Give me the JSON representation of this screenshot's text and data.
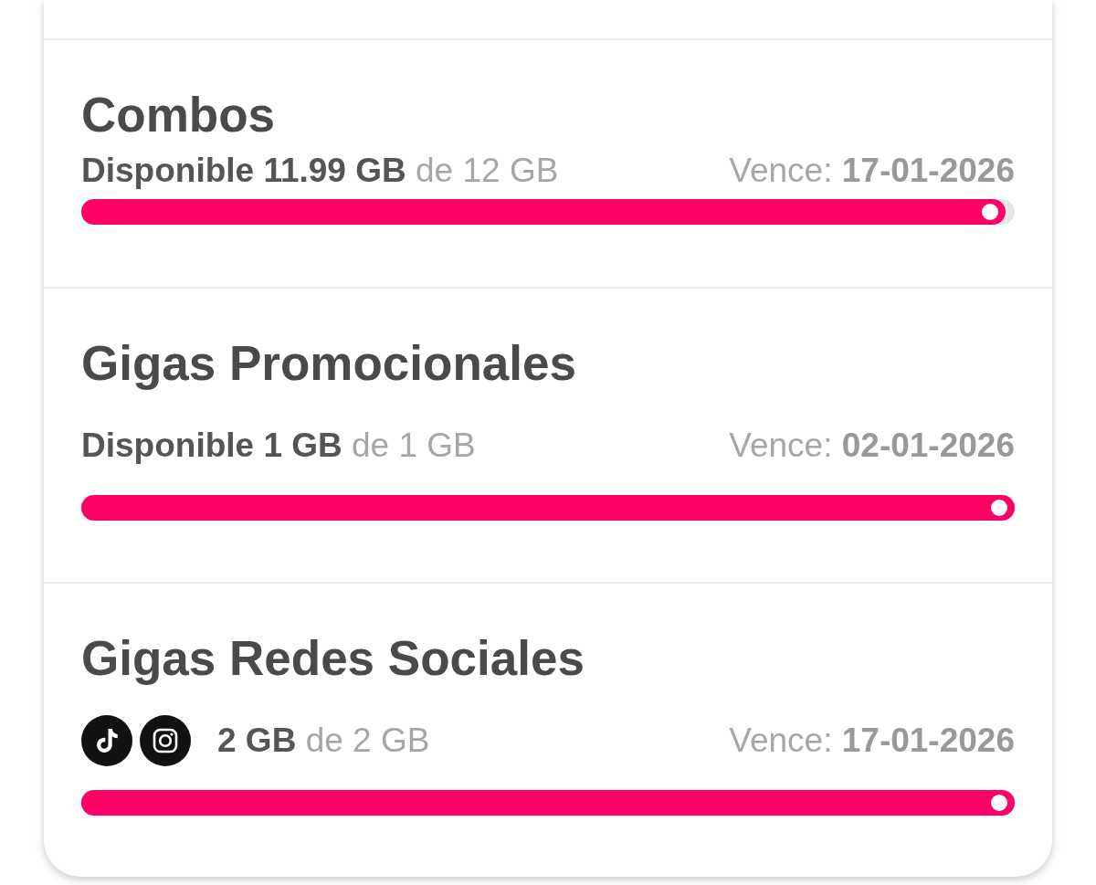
{
  "sections": [
    {
      "title": "Combos",
      "amount": "**Disponible 11.99 GB** de 12 GB",
      "expires": "Vence: **17-01-2026**",
      "level": 0.99
    },
    {
      "title": "Gigas Promocionales",
      "amount": "**Disponible 1 GB** de 1 GB",
      "expires": "Vence: **02-01-2026**",
      "level": 1
    },
    {
      "title": "Gigas Redes Sociales",
      "app_icons": [
        {
          "kind": "note"
        },
        {
          "kind": "camera"
        }
      ],
      "amount": "**2 GB** de 2 GB",
      "expires": "Vence: **17-01-2026**",
      "level": 1
    }
  ]
}
